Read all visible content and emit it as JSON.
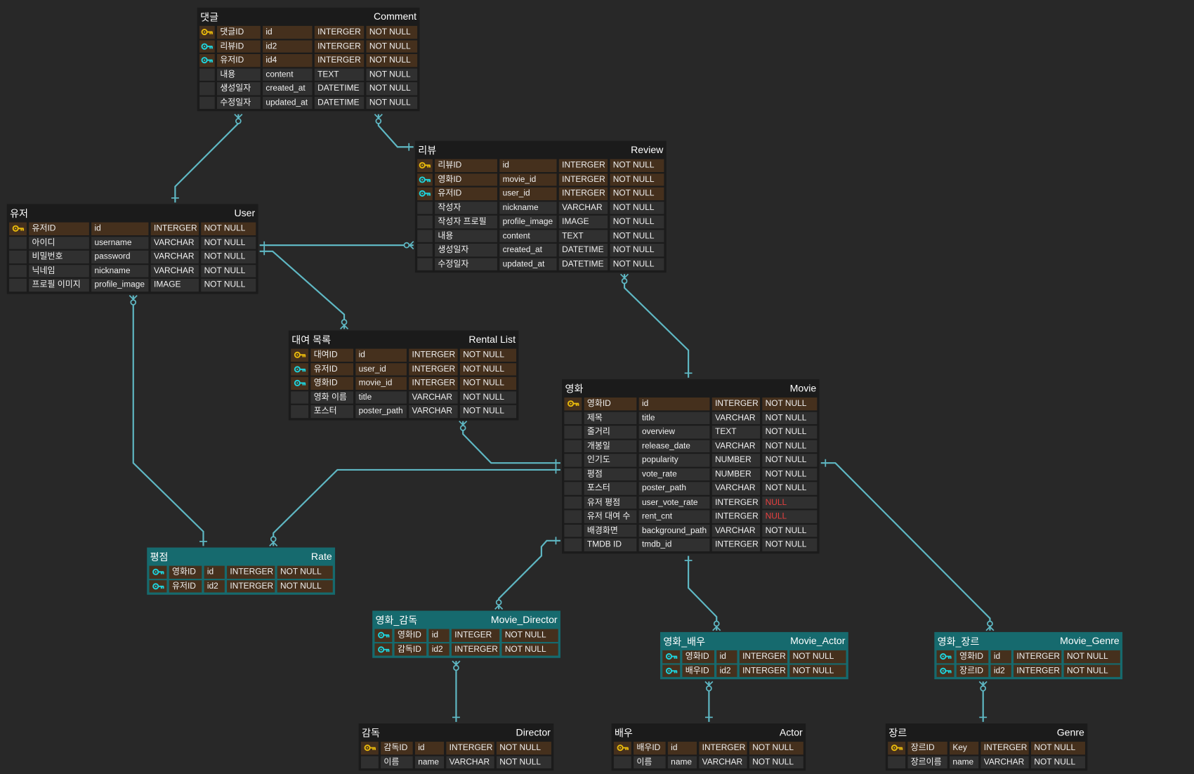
{
  "colors": {
    "line": "#5fb8c4",
    "pk": "#e8b90c",
    "fk": "#1fd3dc",
    "key_row": "#45301d",
    "teal": "#166a6e",
    "null": "#e84040"
  },
  "tables": [
    {
      "id": "comment",
      "ko": "댓글",
      "en": "Comment",
      "style": "dark",
      "rows": [
        [
          "pk",
          "댓글ID",
          "id",
          "INTERGER",
          "NOT NULL"
        ],
        [
          "fk",
          "리뷰ID",
          "id2",
          "INTERGER",
          "NOT NULL"
        ],
        [
          "fk",
          "유저ID",
          "id4",
          "INTERGER",
          "NOT NULL"
        ],
        [
          "",
          "내용",
          "content",
          "TEXT",
          "NOT NULL"
        ],
        [
          "",
          "생성일자",
          "created_at",
          "DATETIME",
          "NOT NULL"
        ],
        [
          "",
          "수정일자",
          "updated_at",
          "DATETIME",
          "NOT NULL"
        ]
      ]
    },
    {
      "id": "review",
      "ko": "리뷰",
      "en": "Review",
      "style": "dark",
      "rows": [
        [
          "pk",
          "리뷰ID",
          "id",
          "INTERGER",
          "NOT NULL"
        ],
        [
          "fk",
          "영화ID",
          "movie_id",
          "INTERGER",
          "NOT NULL"
        ],
        [
          "fk",
          "유저ID",
          "user_id",
          "INTERGER",
          "NOT NULL"
        ],
        [
          "",
          "작성자",
          "nickname",
          "VARCHAR",
          "NOT NULL"
        ],
        [
          "",
          "작성자 프로필",
          "profile_image",
          "IMAGE",
          "NOT NULL"
        ],
        [
          "",
          "내용",
          "content",
          "TEXT",
          "NOT NULL"
        ],
        [
          "",
          "생성일자",
          "created_at",
          "DATETIME",
          "NOT NULL"
        ],
        [
          "",
          "수정일자",
          "updated_at",
          "DATETIME",
          "NOT NULL"
        ]
      ]
    },
    {
      "id": "user",
      "ko": "유저",
      "en": "User",
      "style": "dark",
      "rows": [
        [
          "pk",
          "유저ID",
          "id",
          "INTERGER",
          "NOT NULL"
        ],
        [
          "",
          "아이디",
          "username",
          "VARCHAR",
          "NOT NULL"
        ],
        [
          "",
          "비밀번호",
          "password",
          "VARCHAR",
          "NOT NULL"
        ],
        [
          "",
          "닉네임",
          "nickname",
          "VARCHAR",
          "NOT NULL"
        ],
        [
          "",
          "프로필 이미지",
          "profile_image",
          "IMAGE",
          "NOT NULL"
        ]
      ]
    },
    {
      "id": "rental",
      "ko": "대여 목록",
      "en": "Rental List",
      "style": "dark",
      "rows": [
        [
          "pk",
          "대여ID",
          "id",
          "INTERGER",
          "NOT NULL"
        ],
        [
          "fk",
          "유저ID",
          "user_id",
          "INTERGER",
          "NOT NULL"
        ],
        [
          "fk",
          "영화ID",
          "movie_id",
          "INTERGER",
          "NOT NULL"
        ],
        [
          "",
          "영화 이름",
          "title",
          "VARCHAR",
          "NOT NULL"
        ],
        [
          "",
          "포스터",
          "poster_path",
          "VARCHAR",
          "NOT NULL"
        ]
      ]
    },
    {
      "id": "movie",
      "ko": "영화",
      "en": "Movie",
      "style": "dark",
      "rows": [
        [
          "pk",
          "영화ID",
          "id",
          "INTERGER",
          "NOT NULL"
        ],
        [
          "",
          "제목",
          "title",
          "VARCHAR",
          "NOT NULL"
        ],
        [
          "",
          "줄거리",
          "overview",
          "TEXT",
          "NOT NULL"
        ],
        [
          "",
          "개봉일",
          "release_date",
          "VARCHAR",
          "NOT NULL"
        ],
        [
          "",
          "인기도",
          "popularity",
          "NUMBER",
          "NOT NULL"
        ],
        [
          "",
          "평점",
          "vote_rate",
          "NUMBER",
          "NOT NULL"
        ],
        [
          "",
          "포스터",
          "poster_path",
          "VARCHAR",
          "NOT NULL"
        ],
        [
          "",
          "유저 평점",
          "user_vote_rate",
          "INTERGER",
          "NULL"
        ],
        [
          "",
          "유저 대여 수",
          "rent_cnt",
          "INTERGER",
          "NULL"
        ],
        [
          "",
          "배경화면",
          "background_path",
          "VARCHAR",
          "NOT NULL"
        ],
        [
          "",
          "TMDB ID",
          "tmdb_id",
          "INTERGER",
          "NOT NULL"
        ]
      ]
    },
    {
      "id": "rate",
      "ko": "평점",
      "en": "Rate",
      "style": "teal",
      "rows": [
        [
          "fk",
          "영화ID",
          "id",
          "INTERGER",
          "NOT NULL"
        ],
        [
          "fk",
          "유저ID",
          "id2",
          "INTERGER",
          "NOT NULL"
        ]
      ]
    },
    {
      "id": "movie_director",
      "ko": "영화_감독",
      "en": "Movie_Director",
      "style": "teal",
      "rows": [
        [
          "fk",
          "영화ID",
          "id",
          "INTEGER",
          "NOT NULL"
        ],
        [
          "fk",
          "감독ID",
          "id2",
          "INTERGER",
          "NOT NULL"
        ]
      ]
    },
    {
      "id": "movie_actor",
      "ko": "영화_배우",
      "en": "Movie_Actor",
      "style": "teal",
      "rows": [
        [
          "fk",
          "영화ID",
          "id",
          "INTERGER",
          "NOT NULL"
        ],
        [
          "fk",
          "배우ID",
          "id2",
          "INTERGER",
          "NOT NULL"
        ]
      ]
    },
    {
      "id": "movie_genre",
      "ko": "영화_장르",
      "en": "Movie_Genre",
      "style": "teal",
      "rows": [
        [
          "fk",
          "영화ID",
          "id",
          "INTERGER",
          "NOT NULL"
        ],
        [
          "fk",
          "장르ID",
          "id2",
          "INTERGER",
          "NOT NULL"
        ]
      ]
    },
    {
      "id": "director",
      "ko": "감독",
      "en": "Director",
      "style": "dark",
      "rows": [
        [
          "pk",
          "감독ID",
          "id",
          "INTERGER",
          "NOT NULL"
        ],
        [
          "",
          "이름",
          "name",
          "VARCHAR",
          "NOT NULL"
        ]
      ]
    },
    {
      "id": "actor",
      "ko": "배우",
      "en": "Actor",
      "style": "dark",
      "rows": [
        [
          "pk",
          "배우ID",
          "id",
          "INTERGER",
          "NOT NULL"
        ],
        [
          "",
          "이름",
          "name",
          "VARCHAR",
          "NOT NULL"
        ]
      ]
    },
    {
      "id": "genre",
      "ko": "장르",
      "en": "Genre",
      "style": "dark",
      "rows": [
        [
          "pk",
          "장르ID",
          "Key",
          "INTERGER",
          "NOT NULL"
        ],
        [
          "",
          "장르이름",
          "name",
          "VARCHAR",
          "NOT NULL"
        ]
      ]
    }
  ],
  "relationships": [
    {
      "from": "comment",
      "to": "user"
    },
    {
      "from": "comment",
      "to": "review"
    },
    {
      "from": "review",
      "to": "user"
    },
    {
      "from": "rental",
      "to": "user"
    },
    {
      "from": "rate",
      "to": "user"
    },
    {
      "from": "rental",
      "to": "movie"
    },
    {
      "from": "rate",
      "to": "movie"
    },
    {
      "from": "review",
      "to": "movie"
    },
    {
      "from": "movie_director",
      "to": "movie"
    },
    {
      "from": "movie_actor",
      "to": "movie"
    },
    {
      "from": "movie_genre",
      "to": "movie"
    },
    {
      "from": "movie_director",
      "to": "director"
    },
    {
      "from": "movie_actor",
      "to": "actor"
    },
    {
      "from": "movie_genre",
      "to": "genre"
    }
  ]
}
